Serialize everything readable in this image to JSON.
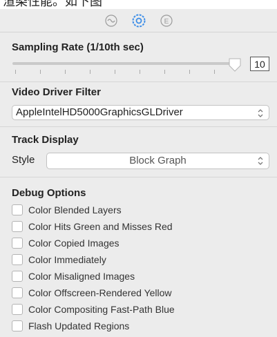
{
  "caption": "渲染性能。如下图",
  "toolbar": {
    "icons": [
      "activity-icon",
      "gear-icon",
      "e-icon"
    ],
    "accent": "#3d8ee8"
  },
  "sampling": {
    "header": "Sampling Rate (1/10th sec)",
    "value": "10",
    "slider_fraction": 1.0
  },
  "video_driver": {
    "header": "Video Driver Filter",
    "selected": "AppleIntelHD5000GraphicsGLDriver"
  },
  "track_display": {
    "header": "Track Display",
    "style_label": "Style",
    "style_selected": "Block Graph"
  },
  "debug": {
    "header": "Debug Options",
    "options": [
      "Color Blended Layers",
      "Color Hits Green and Misses Red",
      "Color Copied Images",
      "Color Immediately",
      "Color Misaligned Images",
      "Color Offscreen-Rendered Yellow",
      "Color Compositing Fast-Path Blue",
      "Flash Updated Regions"
    ]
  }
}
